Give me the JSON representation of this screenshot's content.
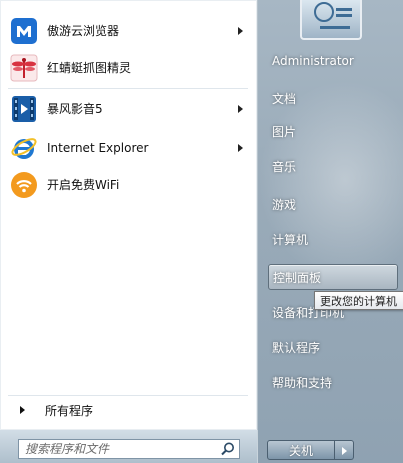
{
  "programs": [
    {
      "label": "傲游云浏览器",
      "icon": "maxthon-browser-icon",
      "has_submenu": true
    },
    {
      "label": "红蜻蜓抓图精灵",
      "icon": "dragonfly-capture-icon",
      "has_submenu": false
    },
    {
      "label": "暴风影音5",
      "icon": "baofeng-player-icon",
      "has_submenu": true
    },
    {
      "label": "Internet Explorer",
      "icon": "internet-explorer-icon",
      "has_submenu": true
    },
    {
      "label": "开启免费WiFi",
      "icon": "wifi-icon",
      "has_submenu": false
    }
  ],
  "all_programs": {
    "label": "所有程序"
  },
  "search": {
    "placeholder": "搜索程序和文件"
  },
  "right_items": [
    {
      "label": "Administrator"
    },
    {
      "label": "文档"
    },
    {
      "label": "图片"
    },
    {
      "label": "音乐"
    },
    {
      "label": "游戏"
    },
    {
      "label": "计算机"
    },
    {
      "label": "控制面板",
      "highlighted": true
    },
    {
      "label": "设备和打印机"
    },
    {
      "label": "默认程序"
    },
    {
      "label": "帮助和支持"
    }
  ],
  "tooltip": {
    "text": "更改您的计算机"
  },
  "shutdown": {
    "label": "关机"
  },
  "colors": {
    "left_bg": "#ffffff",
    "right_panel": "#9aabb9",
    "highlight": "#cfd8df",
    "ie_blue": "#1f78d1",
    "wifi_orange": "#f39a1e"
  }
}
